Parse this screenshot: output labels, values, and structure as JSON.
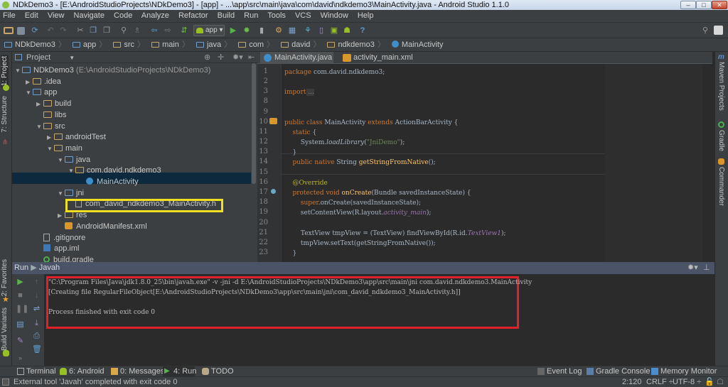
{
  "window": {
    "title": "NDkDemo3 - [E:\\AndroidStudioProjects\\NDkDemo3] - [app] - ...\\app\\src\\main\\java\\com\\david\\ndkdemo3\\MainActivity.java - Android Studio 1.1.0",
    "controls": {
      "minimize": "–",
      "maximize": "□",
      "close": "✕"
    }
  },
  "menu": [
    "File",
    "Edit",
    "View",
    "Navigate",
    "Code",
    "Analyze",
    "Refactor",
    "Build",
    "Run",
    "Tools",
    "VCS",
    "Window",
    "Help"
  ],
  "toolbar": {
    "run_config": "app",
    "icons": [
      "open-folder-icon",
      "save-icon",
      "sync-icon",
      "undo-icon",
      "redo-icon",
      "cut-icon",
      "copy-icon",
      "paste-icon",
      "find-icon",
      "replace-icon",
      "back-icon",
      "forward-icon",
      "make-project-icon",
      "run-icon",
      "debug-icon",
      "attach-debugger-icon",
      "project-structure-icon",
      "sdk-manager-icon",
      "gradle-sync-icon",
      "avd-manager-icon",
      "android-device-monitor-icon",
      "android-icon",
      "help-icon",
      "search-everywhere-icon",
      "user-icon"
    ]
  },
  "breadcrumbs": [
    "NDkDemo3",
    "app",
    "src",
    "main",
    "java",
    "com",
    "david",
    "ndkdemo3",
    "MainActivity"
  ],
  "left_strip": {
    "project": "1: Project",
    "structure": "7: Structure",
    "favorites": "2: Favorites",
    "build_variants": "Build Variants"
  },
  "right_strip": {
    "maven": "Maven Projects",
    "gradle": "Gradle",
    "commander": "Commander"
  },
  "project_panel": {
    "view_selector": "Project",
    "tree": [
      {
        "label": "NDkDemo3",
        "suffix": " (E:\\AndroidStudioProjects\\NDkDemo3)",
        "depth": 0,
        "expanded": "▼",
        "type": "module"
      },
      {
        "label": ".idea",
        "depth": 1,
        "expanded": "▶",
        "type": "folder"
      },
      {
        "label": "app",
        "depth": 1,
        "expanded": "▼",
        "type": "module"
      },
      {
        "label": "build",
        "depth": 2,
        "expanded": "▶",
        "type": "folder"
      },
      {
        "label": "libs",
        "depth": 2,
        "expanded": "",
        "type": "folder"
      },
      {
        "label": "src",
        "depth": 2,
        "expanded": "▼",
        "type": "folder"
      },
      {
        "label": "androidTest",
        "depth": 3,
        "expanded": "▶",
        "type": "folder"
      },
      {
        "label": "main",
        "depth": 3,
        "expanded": "▼",
        "type": "folder"
      },
      {
        "label": "java",
        "depth": 4,
        "expanded": "▼",
        "type": "source"
      },
      {
        "label": "com.david.ndkdemo3",
        "depth": 5,
        "expanded": "▼",
        "type": "package"
      },
      {
        "label": "MainActivity",
        "depth": 6,
        "expanded": "",
        "type": "class",
        "selected": true
      },
      {
        "label": "jni",
        "depth": 4,
        "expanded": "▼",
        "type": "source"
      },
      {
        "label": "com_david_ndkdemo3_MainActivity.h",
        "depth": 5,
        "expanded": "",
        "type": "file",
        "highlighted": true
      },
      {
        "label": "res",
        "depth": 4,
        "expanded": "▶",
        "type": "res"
      },
      {
        "label": "AndroidManifest.xml",
        "depth": 4,
        "expanded": "",
        "type": "xml"
      },
      {
        "label": ".gitignore",
        "depth": 2,
        "expanded": "",
        "type": "file"
      },
      {
        "label": "app.iml",
        "depth": 2,
        "expanded": "",
        "type": "iml"
      },
      {
        "label": "build.gradle",
        "depth": 2,
        "expanded": "",
        "type": "gradle"
      }
    ]
  },
  "editor": {
    "tabs": [
      {
        "label": "MainActivity.java",
        "close": "×",
        "active": true
      },
      {
        "label": "activity_main.xml",
        "close": "×",
        "active": false
      }
    ],
    "line_numbers": [
      "1",
      "2",
      "3",
      "8",
      "9",
      "10",
      "11",
      "12",
      "13",
      "14",
      "15",
      "16",
      "17",
      "18",
      "19",
      "20",
      "21",
      "22",
      "23"
    ],
    "code": {
      "l1_kw": "package",
      "l1_rest": " com.david.ndkdemo3;",
      "l3_kw": "import",
      "l3_fold": " ...",
      "l10_a": "public class",
      "l10_b": " MainActivity ",
      "l10_c": "extends",
      "l10_d": " ActionBarActivity {",
      "l11_kw": "    static",
      "l11_rest": " {",
      "l12_a": "        System.",
      "l12_b": "loadLibrary",
      "l12_c": "(",
      "l12_d": "\"JniDemo\"",
      "l12_e": ");",
      "l13": "    }",
      "l14_kw": "    public native",
      "l14_b": " String ",
      "l14_c": "getStringFromNative",
      "l14_d": "();",
      "l16": "    @Override",
      "l17_kw": "    protected void",
      "l17_b": " onCreate",
      "l17_c": "(Bundle savedInstanceState) {",
      "l18_kw": "        super",
      "l18_rest": ".onCreate(savedInstanceState);",
      "l19_a": "        setContentView(R.layout.",
      "l19_b": "activity_main",
      "l19_c": ");",
      "l21_a": "        TextView tmpView = (TextView) findViewById(R.id.",
      "l21_b": "TextView1",
      "l21_c": ");",
      "l22": "        tmpView.setText(getStringFromNative());",
      "l23": "    }"
    }
  },
  "run_panel": {
    "header_run": "Run",
    "header_config": "Javah",
    "console": [
      "\"C:\\Program Files\\Java\\jdk1.8.0_25\\bin\\javah.exe\" -v -jni -d E:\\AndroidStudioProjects\\NDkDemo3\\app\\src\\main\\jni com.david.ndkdemo3.MainActivity",
      "[Creating file RegularFileObject[E:\\AndroidStudioProjects\\NDkDemo3\\app\\src\\main\\jni\\com_david_ndkdemo3_MainActivity.h]]",
      "",
      "Process finished with exit code 0"
    ]
  },
  "bottom_tabs": [
    {
      "label": "Terminal",
      "active": false
    },
    {
      "label": "6: Android",
      "active": false
    },
    {
      "label": "0: Messages",
      "active": false
    },
    {
      "label": "4: Run",
      "active": true
    },
    {
      "label": "TODO",
      "active": false
    }
  ],
  "bottom_right_tabs": [
    "Event Log",
    "Gradle Console",
    "Memory Monitor"
  ],
  "status": {
    "message": "External tool 'Javah' completed with exit code 0",
    "position": "2:120",
    "line_ending": "CRLF ÷",
    "encoding": "UTF-8 ÷"
  },
  "colors": {
    "highlight_red": "#e0202a",
    "highlight_yellow": "#f0e020",
    "selection": "#0d293e",
    "run_header": "#4a5466"
  }
}
